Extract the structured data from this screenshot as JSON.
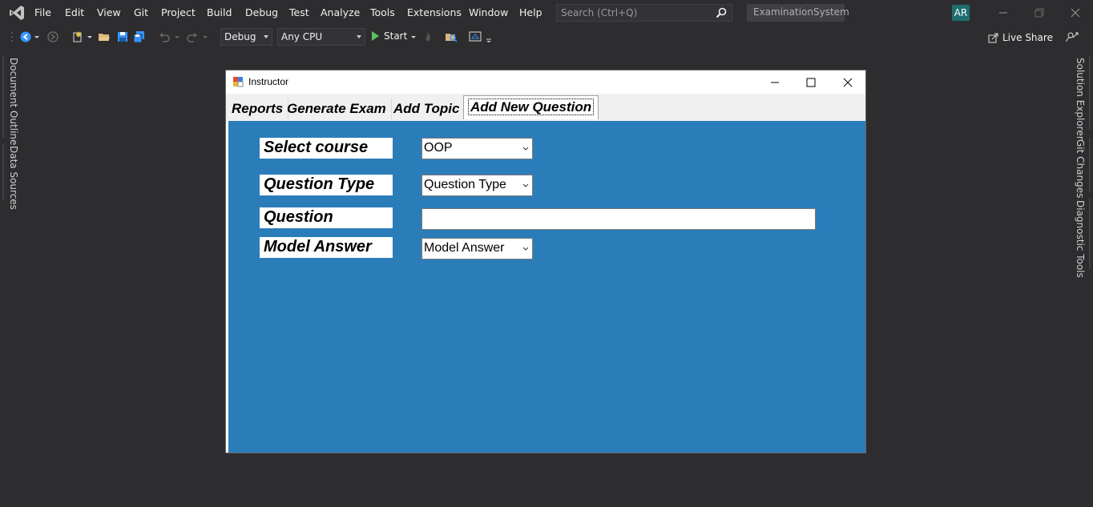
{
  "menubar": {
    "items": [
      "File",
      "Edit",
      "View",
      "Git",
      "Project",
      "Build",
      "Debug",
      "Test",
      "Analyze",
      "Tools",
      "Extensions",
      "Window",
      "Help"
    ],
    "search_placeholder": "Search (Ctrl+Q)",
    "solution_name": "ExaminationSystem",
    "user_initials": "AR"
  },
  "toolbar": {
    "configuration": "Debug",
    "platform": "Any CPU",
    "start_label": "Start",
    "live_share_label": "Live Share"
  },
  "side_tabs": {
    "left": [
      "Document Outline",
      "Data Sources"
    ],
    "right": [
      "Solution Explorer",
      "Git Changes",
      "Diagnostic Tools"
    ]
  },
  "form": {
    "title": "Instructor",
    "tabs": [
      "Reports",
      "Generate Exam",
      "Add Topic",
      "Add New Question"
    ],
    "active_tab": "Add New Question",
    "panel_color": "#2b7dba",
    "fields": {
      "course_label": "Select course",
      "course_value": "OOP",
      "question_type_label": "Question Type",
      "question_type_value": "Question Type",
      "question_label": "Question",
      "question_value": "",
      "model_answer_label": "Model Answer",
      "model_answer_value": "Model Answer"
    }
  },
  "colors": {
    "ide_background": "#2d2d30",
    "accent": "#007acc"
  }
}
